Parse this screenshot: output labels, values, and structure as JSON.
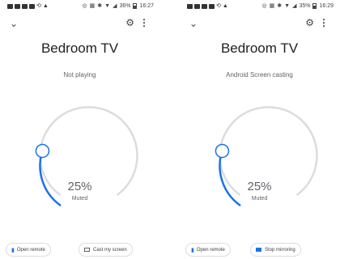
{
  "screens": [
    {
      "status_time": "16:27",
      "status_battery": "36%",
      "title": "Bedroom TV",
      "subtitle": "Not playing",
      "volume_pct": "25%",
      "volume_level": 0.25,
      "muted_label": "Muted",
      "button_open_remote": "Open remote",
      "button_secondary": "Cast my screen",
      "button_secondary_icon": "cast-screen-icon"
    },
    {
      "status_time": "16:29",
      "status_battery": "35%",
      "title": "Bedroom TV",
      "subtitle": "Android Screen casting",
      "volume_pct": "25%",
      "volume_level": 0.25,
      "muted_label": "Muted",
      "button_open_remote": "Open remote",
      "button_secondary": "Stop mirroring",
      "button_secondary_icon": "stop-mirroring-icon"
    }
  ],
  "icons": {
    "chevron": "chevron-down-icon",
    "gear": "gear-icon",
    "more": "more-vert-icon",
    "remote": "remote-icon"
  },
  "colors": {
    "accent": "#1a73e8",
    "track": "#dadce0",
    "text_primary": "#202124",
    "text_secondary": "#5f6368"
  }
}
